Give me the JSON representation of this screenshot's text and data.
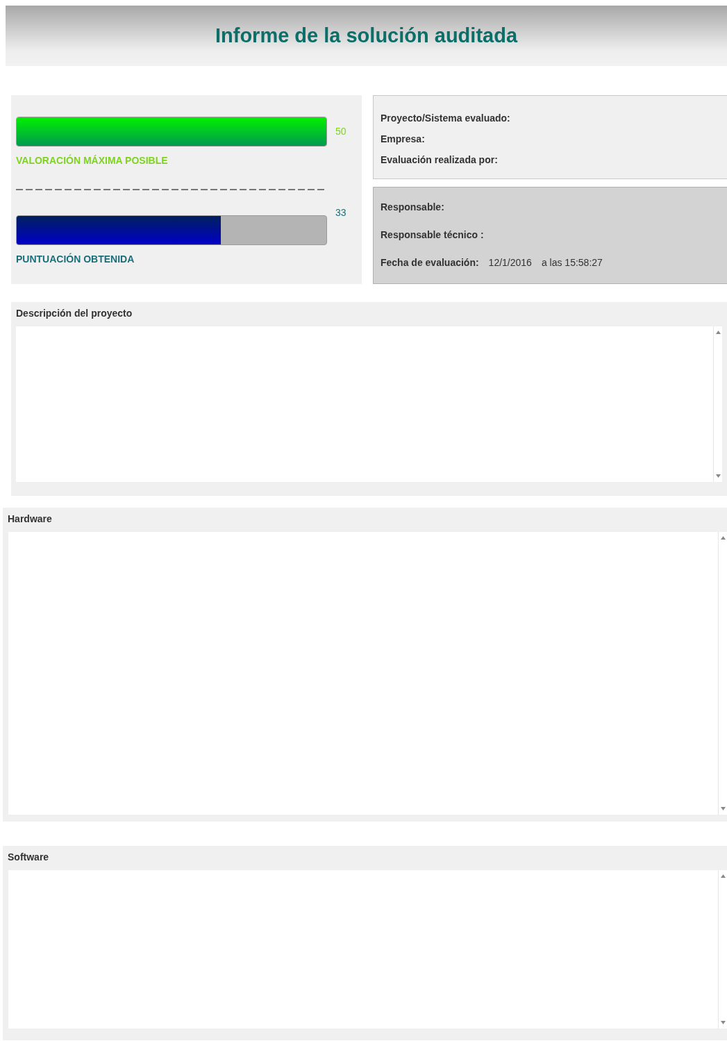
{
  "header": {
    "title": "Informe de la solución auditada"
  },
  "scores": [
    {
      "kind": "max",
      "reading": "50",
      "level": 1,
      "label": "VALORACIÓN MÁXIMA POSIBLE"
    },
    {
      "kind": "obtained",
      "reading": "33",
      "level": 0.66,
      "label": "PUNTUACIÓN OBTENIDA"
    }
  ],
  "project_info": [
    {
      "label": "Proyecto/Sistema evaluado:"
    },
    {
      "label": "Empresa:"
    },
    {
      "label": "Evaluación realizada por:"
    }
  ],
  "responsibility": {
    "responsable": "Responsable:",
    "tecnico": "Responsable técnico :",
    "date_label": "Fecha de evaluación:",
    "date": "12/1/2016",
    "time": "a las 15:58:27"
  },
  "sections": [
    {
      "kind": "short",
      "title": "Descripción del proyecto"
    },
    {
      "kind": "tall",
      "title": "Hardware"
    },
    {
      "kind": "medium",
      "title": "Software"
    }
  ]
}
